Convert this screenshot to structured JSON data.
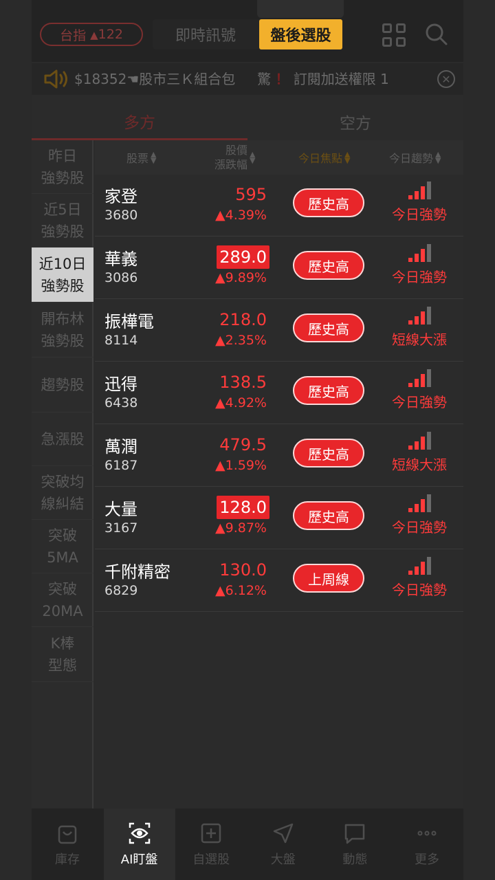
{
  "header": {
    "index_label": "台指",
    "index_change": "122",
    "tabs": [
      "即時訊號",
      "盤後選股"
    ],
    "active_tab": 1
  },
  "marquee": {
    "text": "$18352",
    "text2": "股市三Ｋ組合包",
    "alert": "驚",
    "alert_mark": "！",
    "promo": "訂閱加送權限",
    "promo_tail": "1"
  },
  "mode_tabs": {
    "long": "多方",
    "short": "空方"
  },
  "sidebar": {
    "items": [
      "昨日\n強勢股",
      "近5日\n強勢股",
      "近10日\n強勢股",
      "開布林\n強勢股",
      "趨勢股",
      "急漲股",
      "突破均\n線糾結",
      "突破\n5MA",
      "突破\n20MA",
      "K棒\n型態"
    ],
    "active_index": 2
  },
  "table": {
    "headers": {
      "stock": "股票",
      "price_line1": "股價",
      "price_line2": "漲跌幅",
      "focus": "今日焦點",
      "trend": "今日趨勢"
    },
    "rows": [
      {
        "name": "家登",
        "code": "3680",
        "price": "595",
        "pct": "▲4.39%",
        "limit": false,
        "focus": "歷史高",
        "trend": "今日強勢",
        "strength": 3
      },
      {
        "name": "華義",
        "code": "3086",
        "price": "289.0",
        "pct": "▲9.89%",
        "limit": true,
        "focus": "歷史高",
        "trend": "今日強勢",
        "strength": 3
      },
      {
        "name": "振樺電",
        "code": "8114",
        "price": "218.0",
        "pct": "▲2.35%",
        "limit": false,
        "focus": "歷史高",
        "trend": "短線大漲",
        "strength": 3
      },
      {
        "name": "迅得",
        "code": "6438",
        "price": "138.5",
        "pct": "▲4.92%",
        "limit": false,
        "focus": "歷史高",
        "trend": "今日強勢",
        "strength": 3
      },
      {
        "name": "萬潤",
        "code": "6187",
        "price": "479.5",
        "pct": "▲1.59%",
        "limit": false,
        "focus": "歷史高",
        "trend": "短線大漲",
        "strength": 3
      },
      {
        "name": "大量",
        "code": "3167",
        "price": "128.0",
        "pct": "▲9.87%",
        "limit": true,
        "focus": "歷史高",
        "trend": "今日強勢",
        "strength": 3
      },
      {
        "name": "千附精密",
        "code": "6829",
        "price": "130.0",
        "pct": "▲6.12%",
        "limit": false,
        "focus": "上周線",
        "trend": "今日強勢",
        "strength": 3
      }
    ]
  },
  "bottom_nav": {
    "items": [
      "庫存",
      "AI盯盤",
      "自選股",
      "大盤",
      "動態",
      "更多"
    ],
    "active_index": 1
  },
  "colors": {
    "accent": "#f2b02c",
    "up_red": "#ff3b3b",
    "badge_red": "#e8262a"
  }
}
